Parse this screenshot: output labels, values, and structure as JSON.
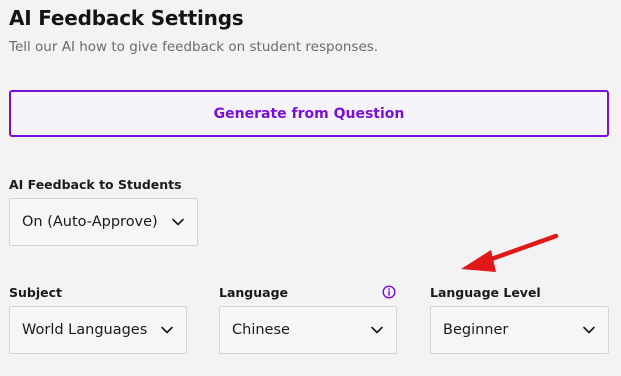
{
  "header": {
    "title": "AI Feedback Settings",
    "subtitle": "Tell our AI how to give feedback on student responses."
  },
  "generate_button": {
    "label": "Generate from Question"
  },
  "feedback_field": {
    "label": "AI Feedback to Students",
    "value": "On (Auto-Approve)"
  },
  "subject_field": {
    "label": "Subject",
    "value": "World Languages"
  },
  "language_field": {
    "label": "Language",
    "value": "Chinese",
    "info_icon": "info-circle-icon"
  },
  "language_level_field": {
    "label": "Language Level",
    "value": "Beginner"
  },
  "colors": {
    "accent": "#7a10d8",
    "annotation_arrow": "#e01818",
    "background": "#f3f3f3"
  },
  "icons": {
    "dropdown": "chevron-down-icon",
    "annotation": "red-arrow-annotation"
  }
}
